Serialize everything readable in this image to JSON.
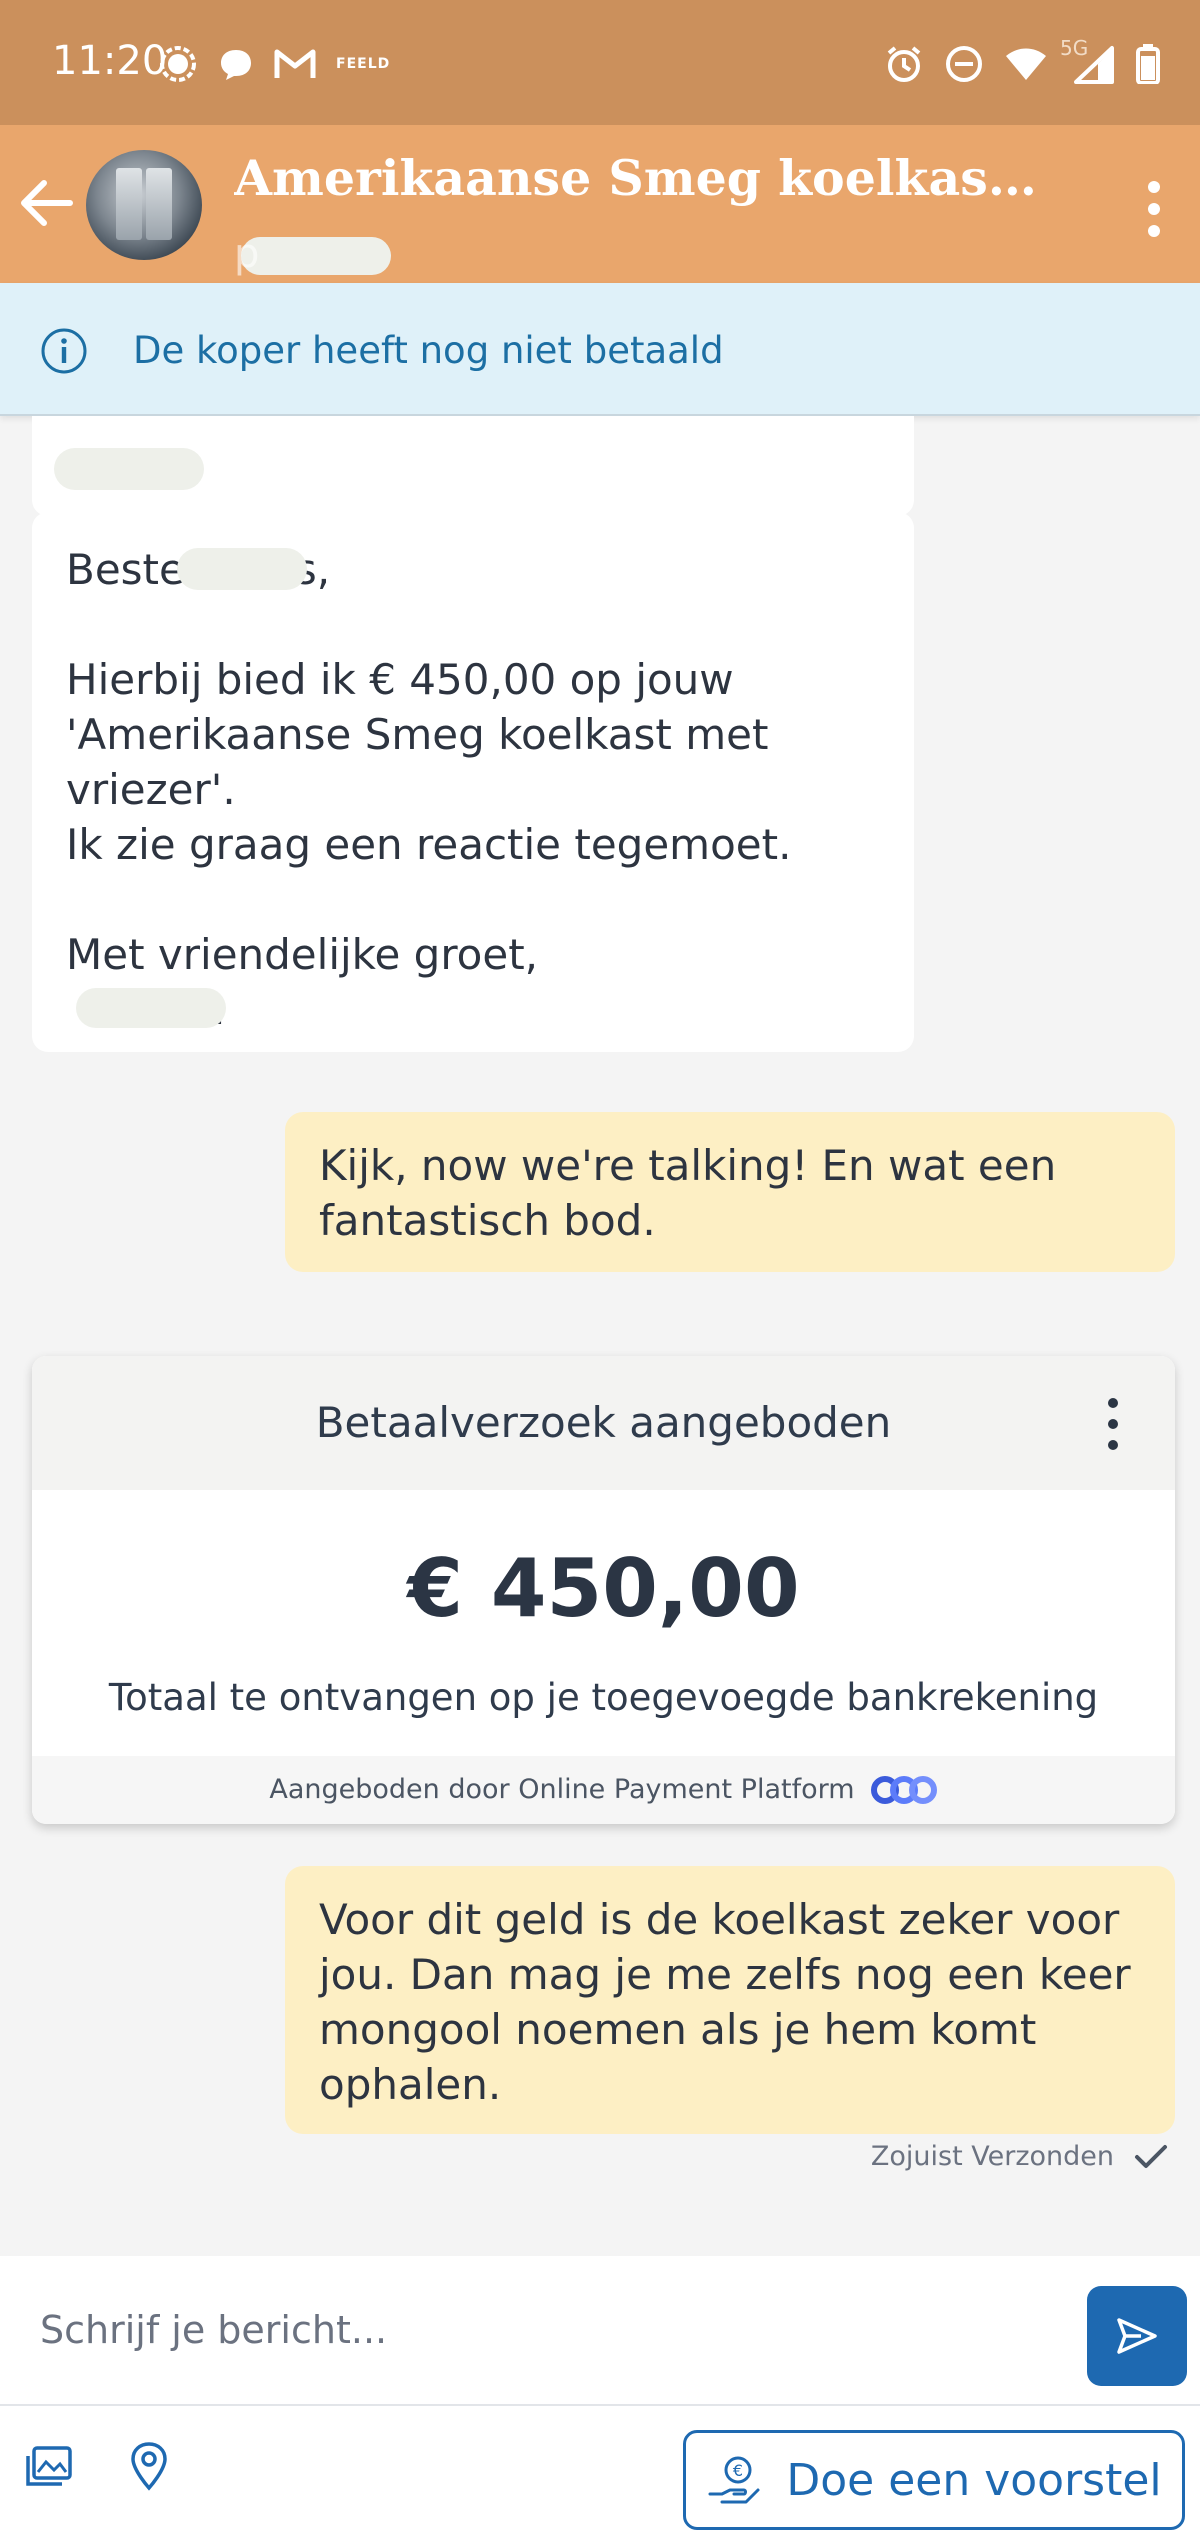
{
  "status_bar": {
    "time": "11:20",
    "left_icons": [
      "signal-app-icon",
      "chat-bubble-icon",
      "gmail-icon",
      "feeld-icon"
    ],
    "feeld_label": "FEELD",
    "network_label": "5G",
    "right_icons": [
      "alarm-icon",
      "do-not-disturb-icon",
      "wifi-icon",
      "cell-signal-icon",
      "battery-icon"
    ]
  },
  "header": {
    "title": "Amerikaanse Smeg koelkast m...",
    "subtitle_initial": "p",
    "back_icon": "arrow-left-icon",
    "menu_icon": "more-vertical-icon"
  },
  "banner": {
    "text": "De koper heeft nog niet betaald",
    "icon": "info-icon"
  },
  "messages": {
    "offer": {
      "greeting_start": "Beste",
      "greeting_end": "s,",
      "body": "Hierbij bied ik € 450,00 op jouw\n'Amerikaanse Smeg koelkast met\nvriezer'.\nIk zie graag een reactie tegemoet.\n\nMet vriendelijke groet,",
      "signature_end": "n"
    },
    "reply1": "Kijk, now we're talking! En wat een\nfantastisch bod.",
    "reply2": "Voor dit geld is de koelkast zeker voor\njou. Dan mag je me zelfs nog een keer\nmongool noemen als je hem komt\nophalen.",
    "sent_status": "Zojuist Verzonden"
  },
  "payment_card": {
    "title": "Betaalverzoek aangeboden",
    "amount": "€ 450,00",
    "description": "Totaal te ontvangen op je toegevoegde bankrekening",
    "footer": "Aangeboden door Online Payment Platform",
    "brand_color": "#3b5bdb"
  },
  "composer": {
    "placeholder": "Schrijf je bericht...",
    "send_icon": "send-icon"
  },
  "bottom_bar": {
    "gallery_icon": "image-gallery-icon",
    "location_icon": "location-pin-icon",
    "proposal_label": "Doe een voorstel",
    "proposal_icon": "hand-euro-icon"
  },
  "colors": {
    "status_bar": "#cb905c",
    "header": "#e9a66c",
    "banner_bg": "#dff1f9",
    "banner_text": "#1c6fa4",
    "outgoing_bubble": "#fdefc4",
    "primary": "#1e69b1"
  }
}
